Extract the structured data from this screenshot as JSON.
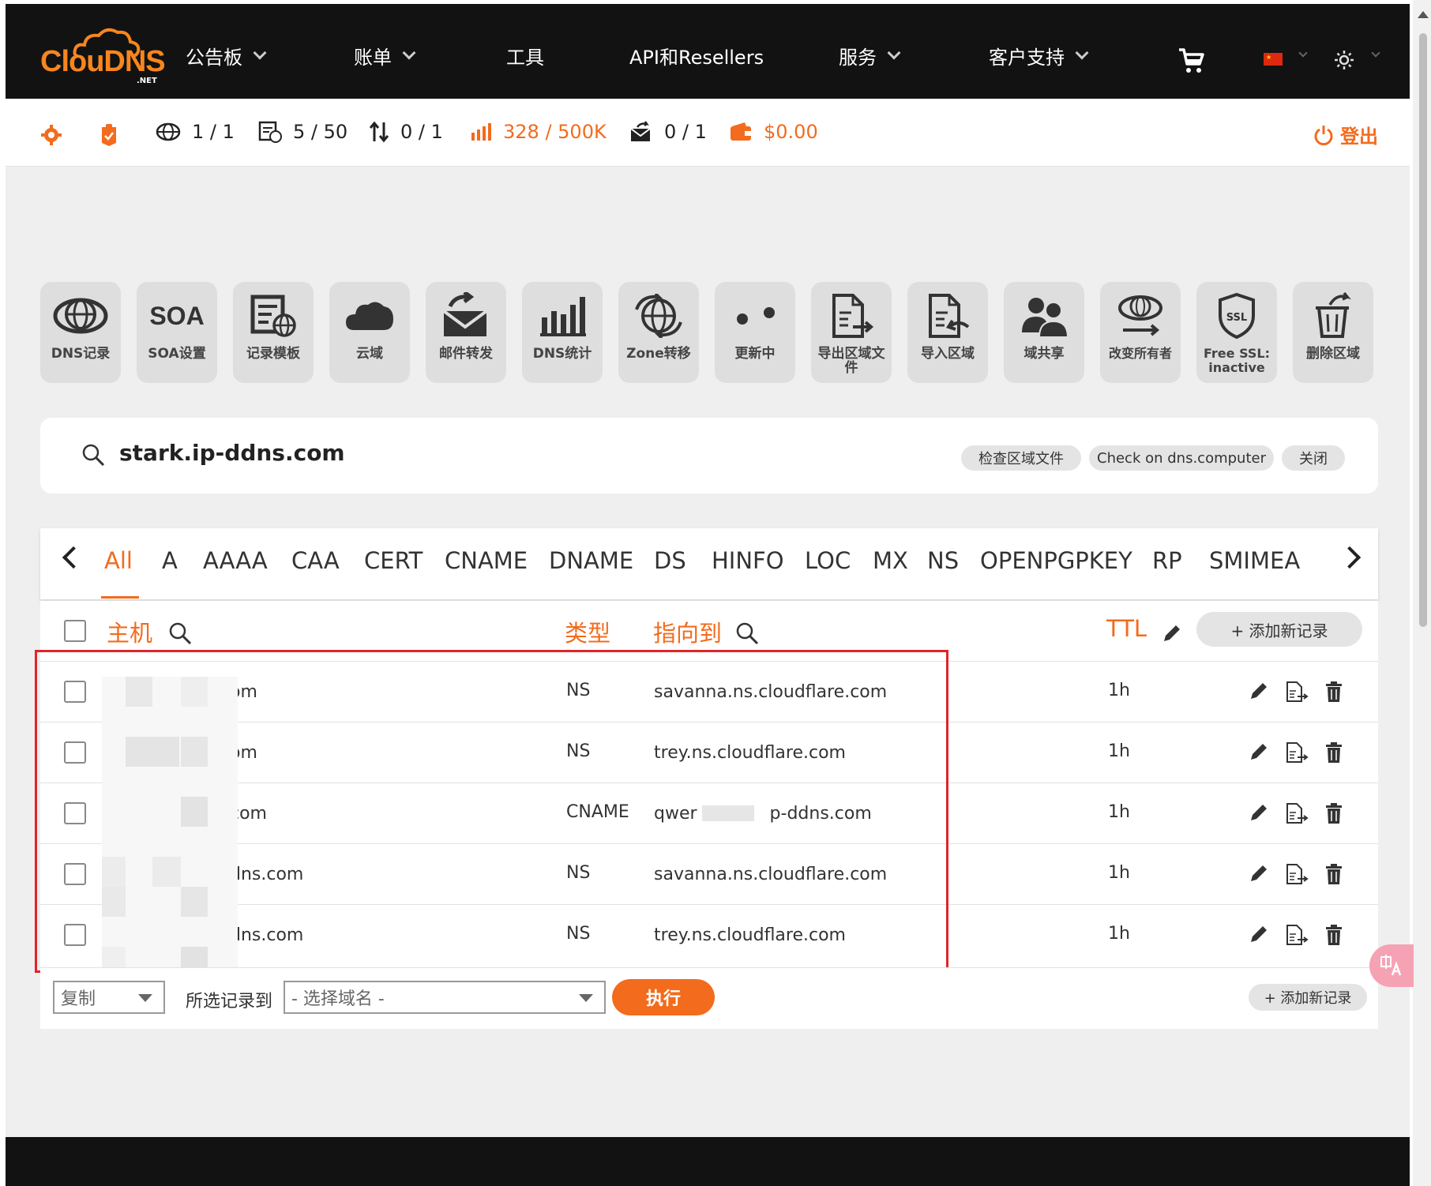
{
  "logo": {
    "text": "ClouDNS",
    "sub": ".NET"
  },
  "nav": {
    "items": [
      {
        "label": "公告板",
        "dropdown": true
      },
      {
        "label": "账单",
        "dropdown": true
      },
      {
        "label": "工具",
        "dropdown": false
      },
      {
        "label": "API和Resellers",
        "dropdown": false
      },
      {
        "label": "服务",
        "dropdown": true
      },
      {
        "label": "客户支持",
        "dropdown": true
      }
    ],
    "cart_icon": "cart-icon",
    "flag_icon": "china-flag-icon",
    "theme_icon": "sun-icon"
  },
  "stats": {
    "zones": "1 / 1",
    "records": "5 / 50",
    "transfers": "0 / 1",
    "queries": "328 / 500K",
    "mail": "0 / 1",
    "balance": "$0.00",
    "logout": "登出"
  },
  "tools": [
    {
      "label": "DNS记录",
      "icon": "globe-icon"
    },
    {
      "label": "SOA设置",
      "icon": "soa-icon"
    },
    {
      "label": "记录模板",
      "icon": "template-icon"
    },
    {
      "label": "云域",
      "icon": "cloud-icon"
    },
    {
      "label": "邮件转发",
      "icon": "mail-forward-icon"
    },
    {
      "label": "DNS统计",
      "icon": "bar-chart-icon"
    },
    {
      "label": "Zone转移",
      "icon": "zone-transfer-icon"
    },
    {
      "label": "更新中",
      "icon": "dots-icon"
    },
    {
      "label": "导出区域文件",
      "icon": "export-file-icon"
    },
    {
      "label": "导入区域",
      "icon": "import-file-icon"
    },
    {
      "label": "域共享",
      "icon": "users-icon"
    },
    {
      "label": "改变所有者",
      "icon": "change-owner-icon"
    },
    {
      "label": "Free SSL: inactive",
      "icon": "ssl-shield-icon"
    },
    {
      "label": "删除区域",
      "icon": "trash-icon"
    }
  ],
  "search": {
    "domain": "stark.ip-ddns.com",
    "buttons": [
      "检查区域文件",
      "Check on dns.computer",
      "关闭"
    ]
  },
  "type_tabs": [
    "All",
    "A",
    "AAAA",
    "CAA",
    "CERT",
    "CNAME",
    "DNAME",
    "DS",
    "HINFO",
    "LOC",
    "MX",
    "NS",
    "OPENPGPKEY",
    "RP",
    "SMIMEA"
  ],
  "active_tab": "All",
  "table": {
    "headers": {
      "host": "主机",
      "type": "类型",
      "points_to": "指向到",
      "ttl": "TTL"
    },
    "add_record": "+ 添加新记录",
    "rows": [
      {
        "host": "om",
        "type": "NS",
        "target": "savanna.ns.cloudflare.com",
        "ttl": "1h"
      },
      {
        "host": "om",
        "type": "NS",
        "target": "trey.ns.cloudflare.com",
        "ttl": "1h"
      },
      {
        "host": "com",
        "type": "CNAME",
        "target": "qwer",
        "target_tail": "p-ddns.com",
        "ttl": "1h"
      },
      {
        "host": "dns.com",
        "type": "NS",
        "target": "savanna.ns.cloudflare.com",
        "ttl": "1h"
      },
      {
        "host": "dns.com",
        "type": "NS",
        "target": "trey.ns.cloudflare.com",
        "ttl": "1h"
      }
    ]
  },
  "footer": {
    "action_select": "复制",
    "to_label": "所选记录到",
    "domain_select": "- 选择域名 -",
    "execute": "执行",
    "add_record": "+ 添加新记录"
  },
  "colors": {
    "accent": "#f36b1c",
    "nav_bg": "#121212",
    "highlight_border": "#e0242b"
  }
}
